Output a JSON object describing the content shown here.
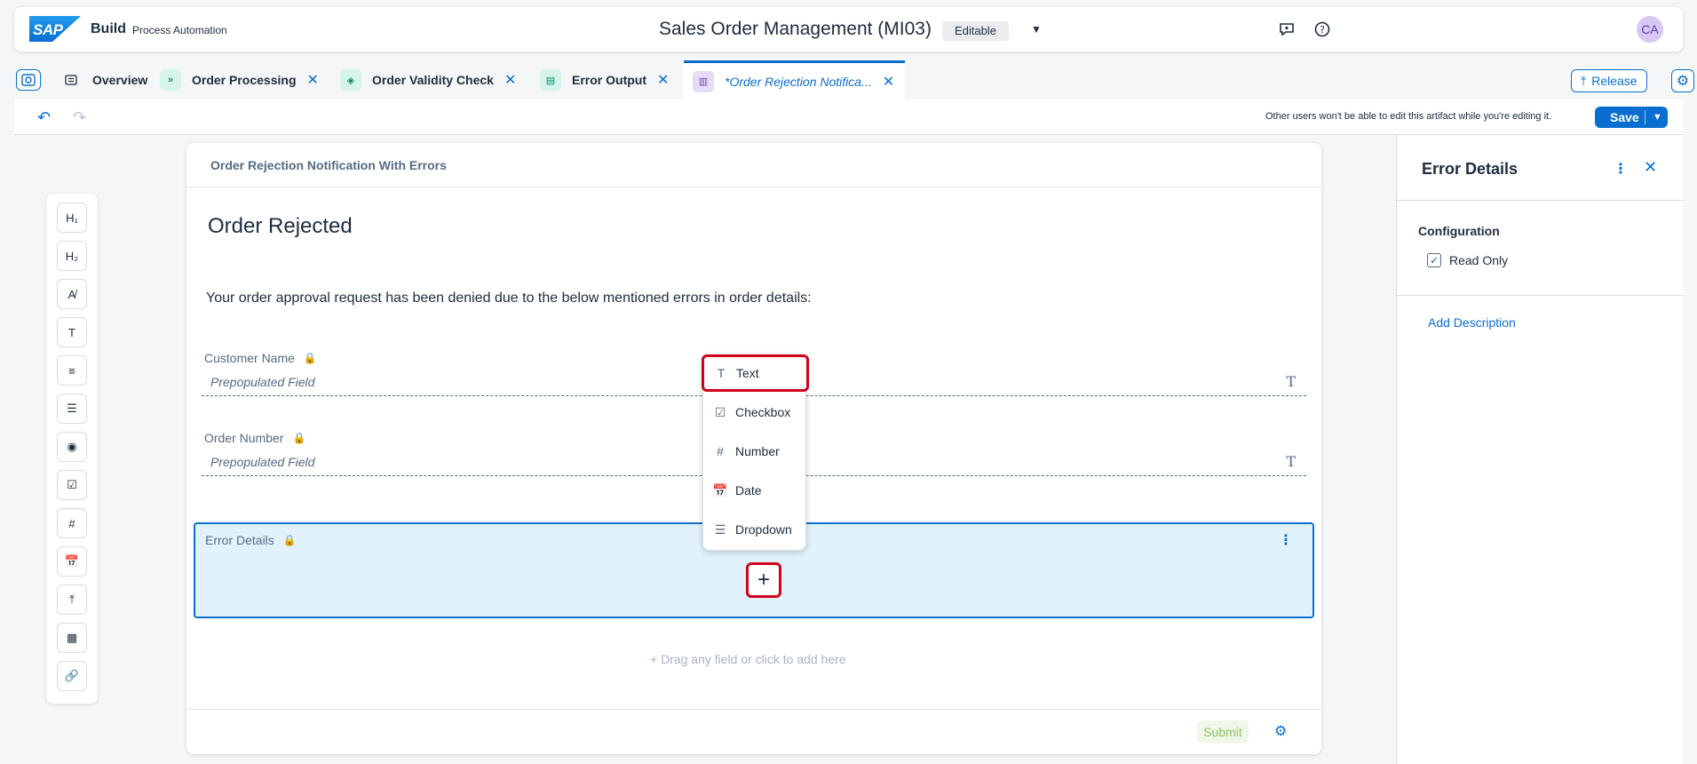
{
  "shell": {
    "logo_text": "SAP",
    "brand": "Build",
    "product": "Process Automation",
    "title": "Sales Order Management (MI03)",
    "status": "Editable",
    "avatar": "CA"
  },
  "tabs": [
    {
      "label": "Overview"
    },
    {
      "label": "Order Processing"
    },
    {
      "label": "Order Validity Check"
    },
    {
      "label": "Error Output"
    },
    {
      "label": "*Order Rejection Notifica..."
    }
  ],
  "tab_actions": {
    "release": "Release"
  },
  "toolbar": {
    "message": "Other users won't be able to edit this artifact while you're editing it.",
    "save": "Save"
  },
  "palette": [
    "H₁",
    "H₂",
    "A̸",
    "T",
    "≡",
    "☰",
    "◉",
    "☑",
    "#",
    "📅",
    "⤒",
    "▦",
    "🔗"
  ],
  "form": {
    "header": "Order Rejection Notification With Errors",
    "heading": "Order Rejected",
    "paragraph": "Your order approval request has been denied due to the below mentioned errors in order details:",
    "fields": [
      {
        "label": "Customer Name",
        "placeholder": "Prepopulated Field"
      },
      {
        "label": "Order Number",
        "placeholder": "Prepopulated Field"
      }
    ],
    "section_title": "Error Details",
    "drag_hint": "+ Drag any field or click to add here",
    "submit": "Submit"
  },
  "popup": [
    {
      "label": "Text",
      "icon": "T"
    },
    {
      "label": "Checkbox",
      "icon": "☑"
    },
    {
      "label": "Number",
      "icon": "#"
    },
    {
      "label": "Date",
      "icon": "📅"
    },
    {
      "label": "Dropdown",
      "icon": "☰"
    }
  ],
  "panel": {
    "title": "Error Details",
    "config": "Configuration",
    "readonly": "Read Only",
    "add_description": "Add Description"
  },
  "colors": {
    "accent": "#0a6ed1",
    "highlight": "#d0021b",
    "section_bg": "#e1f2fd"
  }
}
